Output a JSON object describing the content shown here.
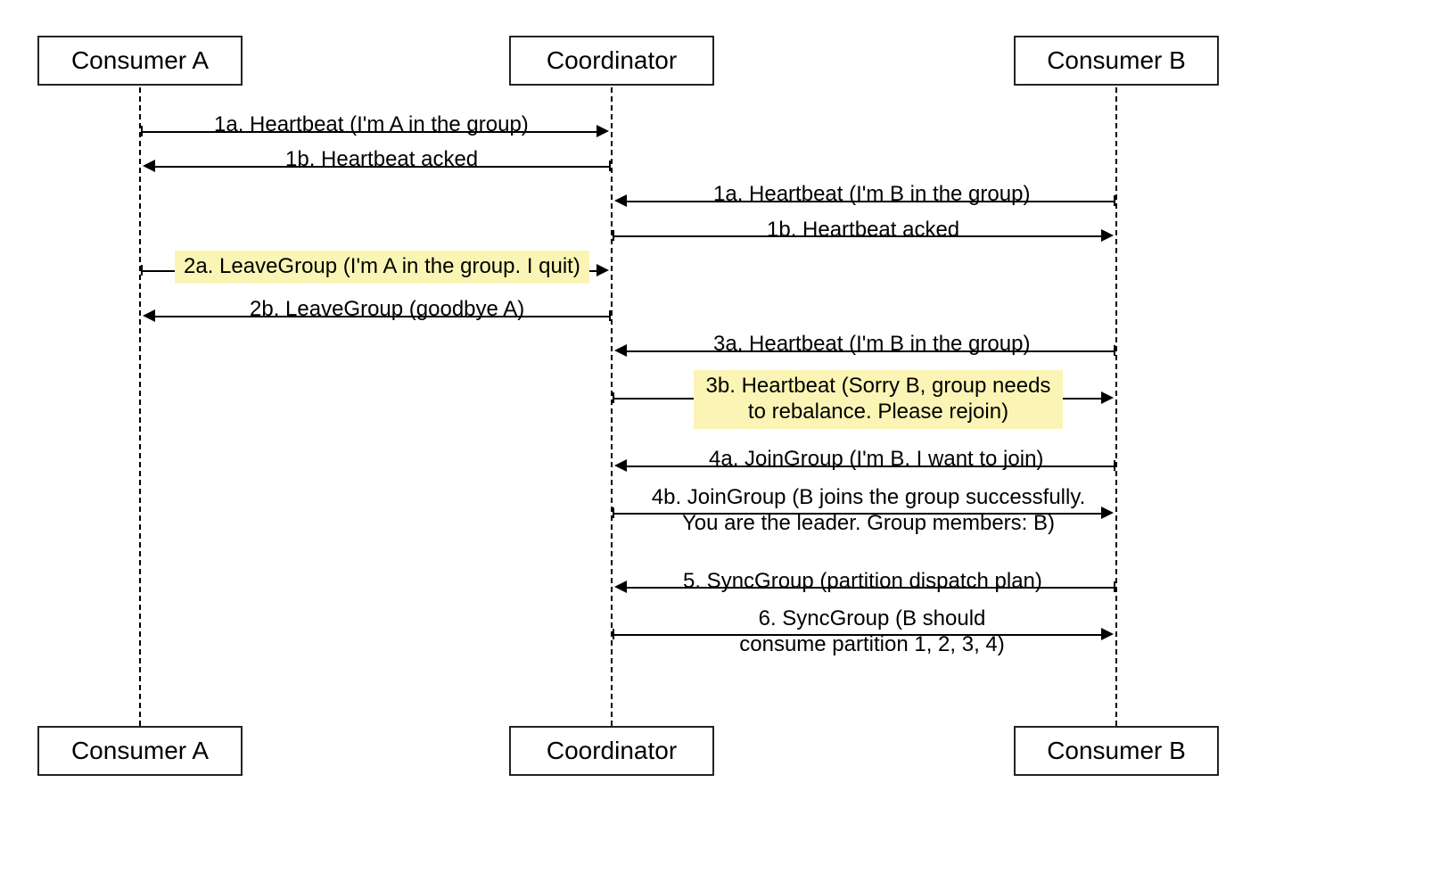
{
  "diagram": {
    "actors": {
      "a": "Consumer A",
      "coord": "Coordinator",
      "b": "Consumer B"
    },
    "messages": {
      "m1a": "1a. Heartbeat (I'm A in the group)",
      "m1b": "1b. Heartbeat acked",
      "m1a_b": "1a. Heartbeat (I'm B in the group)",
      "m1b_b": "1b. Heartbeat acked",
      "m2a": "2a. LeaveGroup (I'm A in the group. I quit)",
      "m2b": "2b. LeaveGroup (goodbye A)",
      "m3a": "3a. Heartbeat (I'm B in the group)",
      "m3b": "3b. Heartbeat (Sorry B, group needs to rebalance. Please rejoin)",
      "m4a": "4a. JoinGroup (I'm B. I want to join)",
      "m4b": "4b. JoinGroup (B joins the group successfully. You are the leader. Group members: B)",
      "m5": "5. SyncGroup (partition dispatch plan)",
      "m6": "6. SyncGroup (B should consume partition 1, 2, 3, 4)"
    }
  }
}
